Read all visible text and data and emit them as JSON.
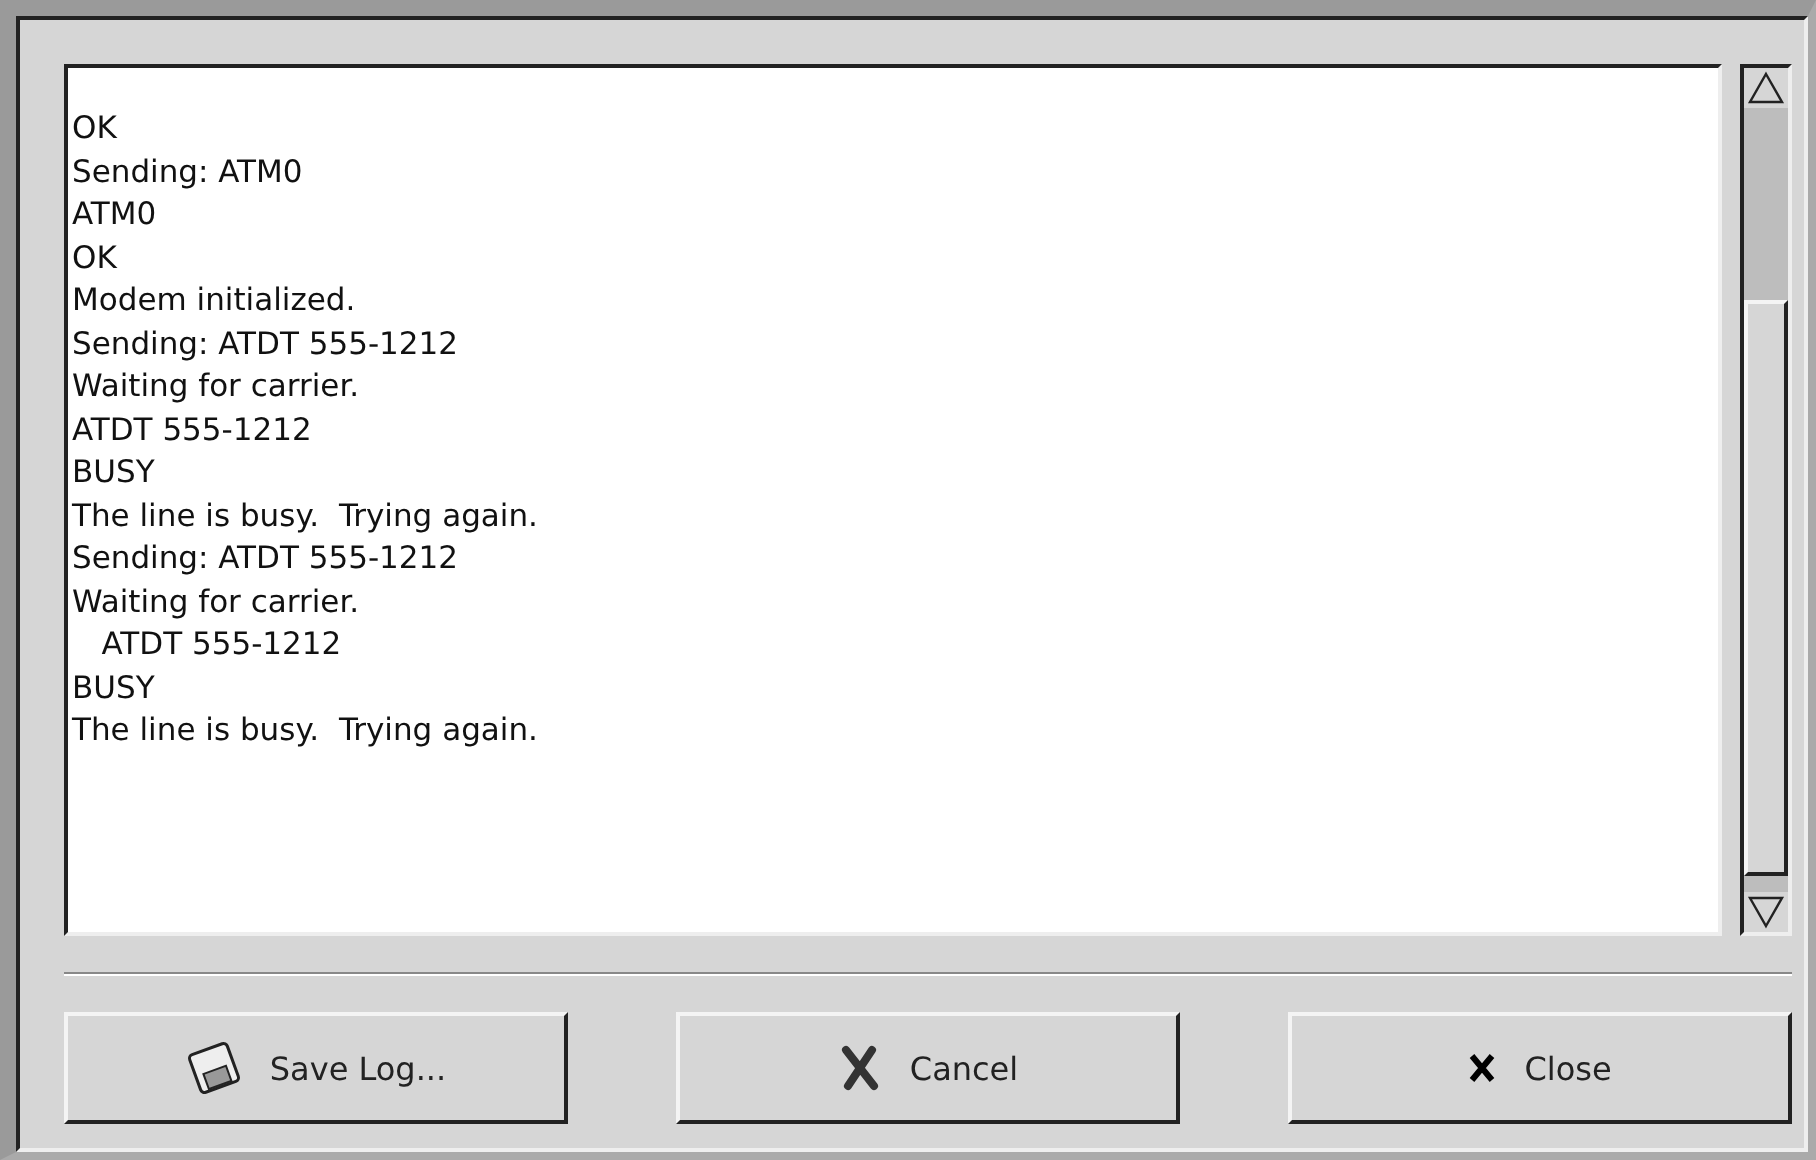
{
  "log_lines": [
    "OK",
    "Sending: ATM0",
    "ATM0",
    "OK",
    "Modem initialized.",
    "Sending: ATDT 555-1212",
    "Waiting for carrier.",
    "ATDT 555-1212",
    "BUSY",
    "The line is busy.  Trying again.",
    "Sending: ATDT 555-1212",
    "Waiting for carrier.",
    "   ATDT 555-1212",
    "BUSY",
    "The line is busy.  Trying again."
  ],
  "buttons": [
    {
      "label": "Save Log...",
      "kind": "save"
    },
    {
      "label": "Cancel",
      "kind": "cancel"
    },
    {
      "label": "Close",
      "kind": "close"
    }
  ]
}
